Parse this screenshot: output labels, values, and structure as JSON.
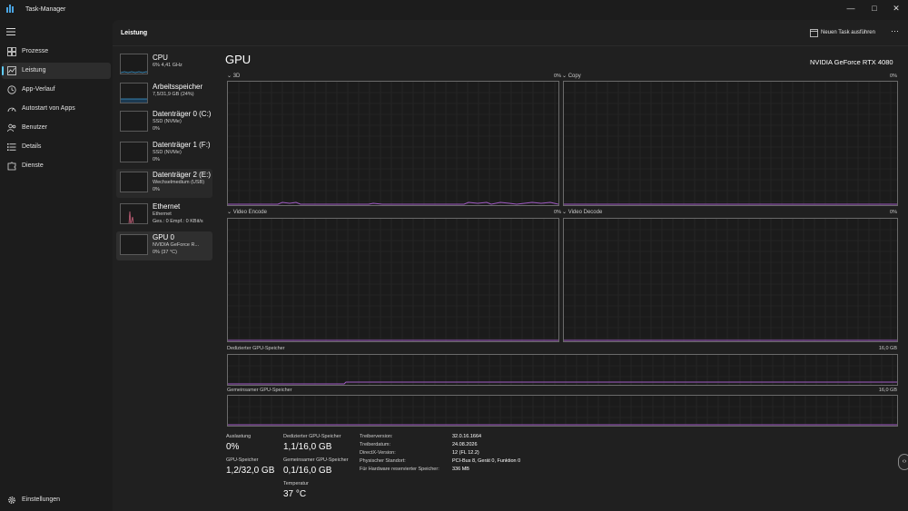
{
  "window": {
    "title": "Task-Manager",
    "controls": {
      "minimize": "—",
      "maximize": "□",
      "close": "✕"
    }
  },
  "nav": {
    "items": [
      {
        "label": "Prozesse",
        "icon": "processes-grid-icon"
      },
      {
        "label": "Leistung",
        "icon": "performance-graph-icon",
        "active": true
      },
      {
        "label": "App-Verlauf",
        "icon": "history-clock-icon"
      },
      {
        "label": "Autostart von Apps",
        "icon": "startup-gauge-icon"
      },
      {
        "label": "Benutzer",
        "icon": "users-icon"
      },
      {
        "label": "Details",
        "icon": "details-list-icon"
      },
      {
        "label": "Dienste",
        "icon": "services-puzzle-icon"
      }
    ],
    "settings_label": "Einstellungen"
  },
  "header": {
    "title": "Leistung",
    "run_task_label": "Neuen Task ausführen",
    "more_label": "⋯"
  },
  "devices": [
    {
      "name": "CPU",
      "line1": "6% 4,41 GHz",
      "line2": "",
      "accent": "#3f9ed6"
    },
    {
      "name": "Arbeitsspeicher",
      "line1": "7,5/31,9 GB (24%)",
      "line2": "",
      "accent": "#3f9ed6"
    },
    {
      "name": "Datenträger 0 (C:)",
      "line1": "SSD (NVMe)",
      "line2": "0%",
      "accent": "#5bbd5b"
    },
    {
      "name": "Datenträger 1 (F:)",
      "line1": "SSD (NVMe)",
      "line2": "0%",
      "accent": "#5bbd5b"
    },
    {
      "name": "Datenträger 2 (E:)",
      "line1": "Wechselmedium (USB)",
      "line2": "0%",
      "accent": "#5bbd5b"
    },
    {
      "name": "Ethernet",
      "line1": "Ethernet",
      "line2": "Ges.: 0 Empf.: 0 KBit/s",
      "accent": "#c7607a"
    },
    {
      "name": "GPU 0",
      "line1": "NVIDIA GeForce R...",
      "line2": "0% (37 °C)",
      "accent": "#a35cc7",
      "selected": true
    }
  ],
  "gpu": {
    "title": "GPU",
    "model": "NVIDIA GeForce RTX 4080",
    "accent": "#a35cc7",
    "engines": [
      {
        "label": "3D",
        "percent": "0%"
      },
      {
        "label": "Copy",
        "percent": "0%"
      },
      {
        "label": "Video Encode",
        "percent": "0%"
      },
      {
        "label": "Video Decode",
        "percent": "0%"
      }
    ],
    "dedicated_mem": {
      "label": "Dedizierter GPU-Speicher",
      "max": "16,0 GB"
    },
    "shared_mem": {
      "label": "Gemeinsamer GPU-Speicher",
      "max": "16,0 GB"
    },
    "stats": {
      "utilization_label": "Auslastung",
      "utilization_value": "0%",
      "gpu_mem_label": "GPU-Speicher",
      "gpu_mem_value": "1,2/32,0 GB",
      "dedicated_label": "Dedizierter GPU-Speicher",
      "dedicated_value": "1,1/16,0 GB",
      "shared_label": "Gemeinsamer GPU-Speicher",
      "shared_value": "0,1/16,0 GB",
      "temp_label": "Temperatur",
      "temp_value": "37 °C"
    },
    "info": [
      {
        "key": "Treiberversion:",
        "value": "32.0.16.1664"
      },
      {
        "key": "Treiberdatum:",
        "value": "24.08.2026"
      },
      {
        "key": "DirectX-Version:",
        "value": "12 (FL 12.2)"
      },
      {
        "key": "Physischer Standort:",
        "value": "PCI-Bus 8, Gerät 0, Funktion 0"
      },
      {
        "key": "Für Hardware reservierter Speicher:",
        "value": "336 MB"
      }
    ]
  }
}
